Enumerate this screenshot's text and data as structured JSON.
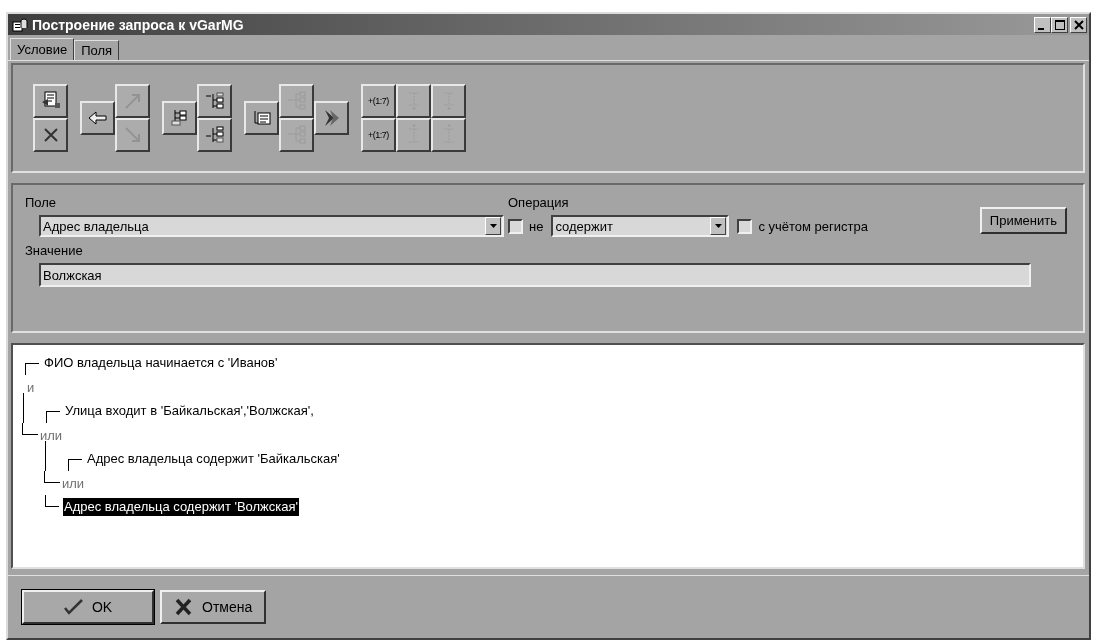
{
  "window": {
    "title": "Построение запроса к vGarMG"
  },
  "tabs": [
    {
      "label": "Условие",
      "selected": true
    },
    {
      "label": "Поля",
      "selected": false
    }
  ],
  "toolbar": {
    "groups": [
      {
        "kind": "stack",
        "buttons": [
          {
            "disabled": false
          },
          {
            "disabled": false
          }
        ]
      },
      {
        "kind": "left-stack",
        "buttons": [
          {
            "disabled": false
          },
          {
            "disabled": true
          },
          {
            "disabled": true
          }
        ]
      },
      {
        "kind": "left-stack",
        "buttons": [
          {
            "disabled": false
          },
          {
            "disabled": false
          },
          {
            "disabled": false
          }
        ]
      },
      {
        "kind": "left-stack-right",
        "buttons": [
          {
            "disabled": false
          },
          {
            "disabled": true
          },
          {
            "disabled": true
          },
          {
            "disabled": false
          }
        ]
      },
      {
        "kind": "grid",
        "buttons": [
          {
            "label": "+(1:7)",
            "disabled": false
          },
          {
            "disabled": true
          },
          {
            "disabled": true
          },
          {
            "label": "+(1:7)",
            "disabled": false
          },
          {
            "disabled": true
          },
          {
            "disabled": true
          }
        ]
      }
    ]
  },
  "filter": {
    "field_label": "Поле",
    "field_value": "Адрес владельца",
    "operation_label": "Операция",
    "not_checkbox": {
      "label": "не",
      "checked": false
    },
    "operation_value": "содержит",
    "case_checkbox": {
      "label": "с учётом регистра",
      "checked": false
    },
    "apply_button": "Применить",
    "value_label": "Значение",
    "value": "Волжская"
  },
  "tree": {
    "items": [
      {
        "kind": "condition",
        "text": "ФИО владельца начинается с 'Иванов'",
        "selected": false
      },
      {
        "kind": "operator",
        "text": "и"
      },
      {
        "kind": "group",
        "children": [
          {
            "kind": "condition",
            "text": "Улица входит в 'Байкальская','Волжская',",
            "selected": false
          },
          {
            "kind": "operator",
            "text": "или"
          },
          {
            "kind": "group",
            "children": [
              {
                "kind": "condition",
                "text": "Адрес владельца содержит 'Байкальская'",
                "selected": false
              },
              {
                "kind": "operator",
                "text": "или"
              },
              {
                "kind": "condition",
                "text": "Адрес владельца содержит 'Волжская'",
                "selected": true
              }
            ]
          }
        ]
      }
    ]
  },
  "buttons": [
    {
      "kind": "ok",
      "label": "OK"
    },
    {
      "kind": "cancel",
      "label": "Отмена"
    }
  ]
}
